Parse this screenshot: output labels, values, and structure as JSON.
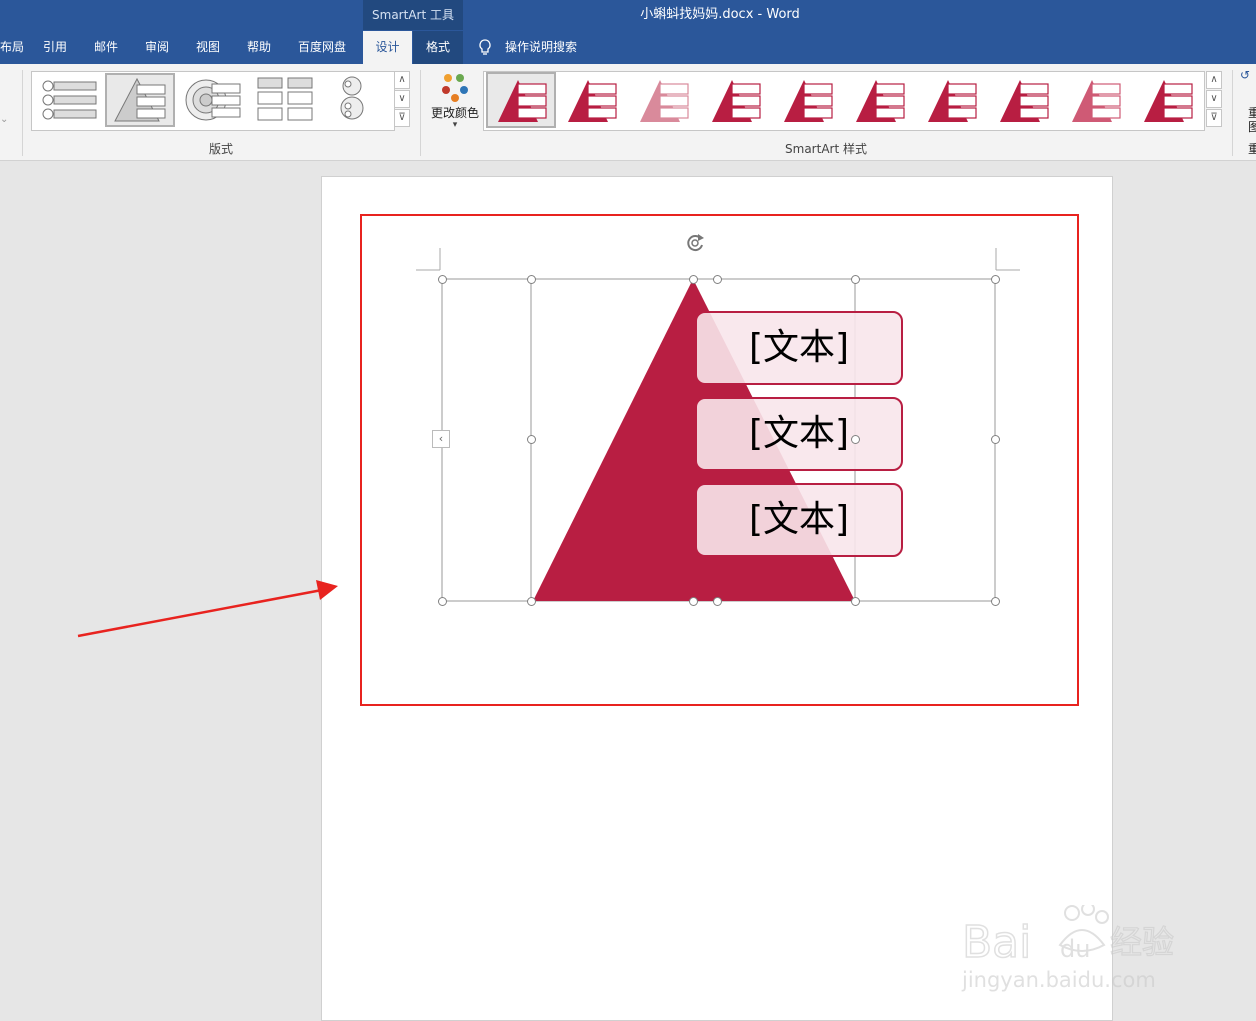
{
  "window": {
    "contextual_label": "SmartArt 工具",
    "doc_title": "小蝌蚪找妈妈.docx  -  Word"
  },
  "tabs": [
    {
      "label": "布局"
    },
    {
      "label": "引用"
    },
    {
      "label": "邮件"
    },
    {
      "label": "审阅"
    },
    {
      "label": "视图"
    },
    {
      "label": "帮助"
    },
    {
      "label": "百度网盘"
    },
    {
      "label": "设计"
    },
    {
      "label": "格式"
    },
    {
      "label": "操作说明搜索"
    }
  ],
  "ribbon": {
    "layouts_group": "版式",
    "styles_group": "SmartArt 样式",
    "change_colors": "更改颜色",
    "right_cut_labels": [
      "重",
      "图",
      "重"
    ]
  },
  "smartart": {
    "items": [
      "[文本]",
      "[文本]",
      "[文本]"
    ]
  },
  "colors": {
    "accent": "#b81e42",
    "titlebar": "#2b579a",
    "selection_border": "#e8231f"
  },
  "watermark": "Baidu经验 jingyan.baidu.com"
}
